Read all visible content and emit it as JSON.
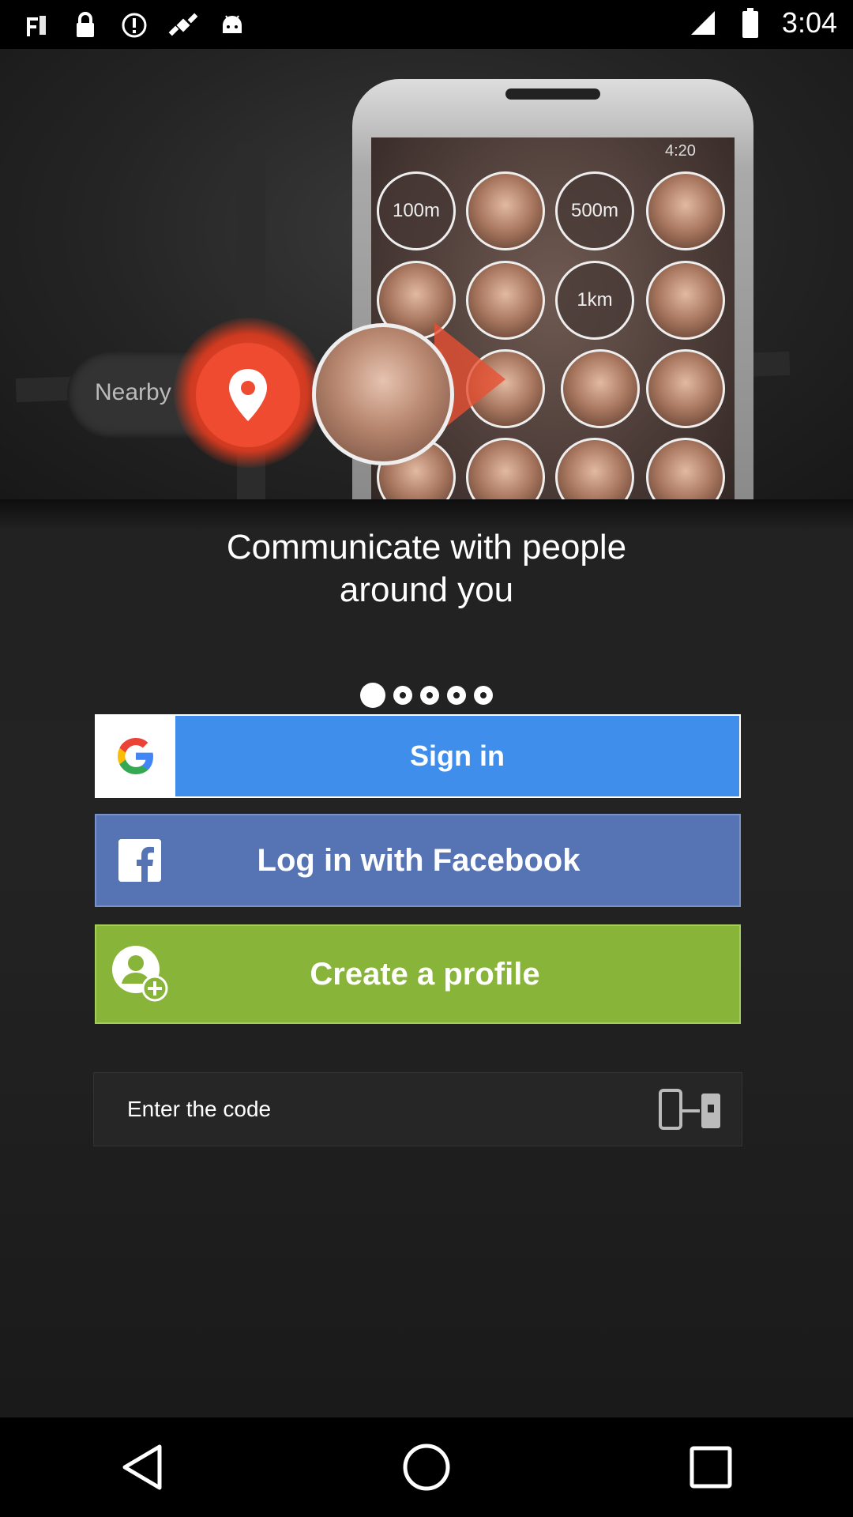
{
  "status_bar": {
    "time": "3:04",
    "icons": [
      "wifi-icon",
      "lock-icon",
      "sync-icon",
      "satellite-icon",
      "android-icon"
    ]
  },
  "hero": {
    "nearby_label": "Nearby",
    "phone_time": "4:20",
    "distance_labels": [
      "100m",
      "500m",
      "1km"
    ]
  },
  "headline": {
    "line1": "Communicate with people",
    "line2": "around you"
  },
  "pager": {
    "count": 5,
    "active_index": 0
  },
  "buttons": {
    "google": "Sign in",
    "facebook": "Log in with Facebook",
    "create_profile": "Create a profile"
  },
  "code_field": {
    "label": "Enter the code"
  },
  "colors": {
    "google_blue": "#3f8eec",
    "facebook_blue": "#5673b4",
    "create_green": "#88b43a",
    "pin_red": "#ee4b30"
  },
  "nav_bar": {
    "icons": [
      "back-icon",
      "home-icon",
      "recents-icon"
    ]
  }
}
